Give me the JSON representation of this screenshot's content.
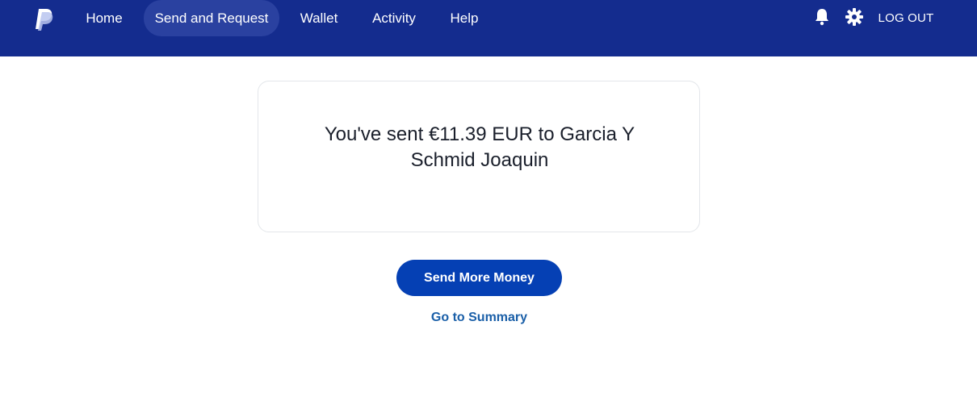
{
  "header": {
    "logo_icon": "paypal-logo",
    "nav": [
      {
        "label": "Home"
      },
      {
        "label": "Send and Request",
        "active": true
      },
      {
        "label": "Wallet"
      },
      {
        "label": "Activity"
      },
      {
        "label": "Help"
      }
    ],
    "notifications_icon": "bell-icon",
    "settings_icon": "gear-icon",
    "logout_label": "LOG OUT"
  },
  "confirmation": {
    "message": "You've sent €11.39 EUR to Garcia Y Schmid Joaquin"
  },
  "actions": {
    "send_more_label": "Send More Money",
    "summary_link_label": "Go to Summary"
  },
  "colors": {
    "header_bg": "#142c8e",
    "active_nav_bg": "#2a41a0",
    "primary_button": "#0540b4",
    "link": "#1a5fa8",
    "text": "#1a1f2b"
  }
}
